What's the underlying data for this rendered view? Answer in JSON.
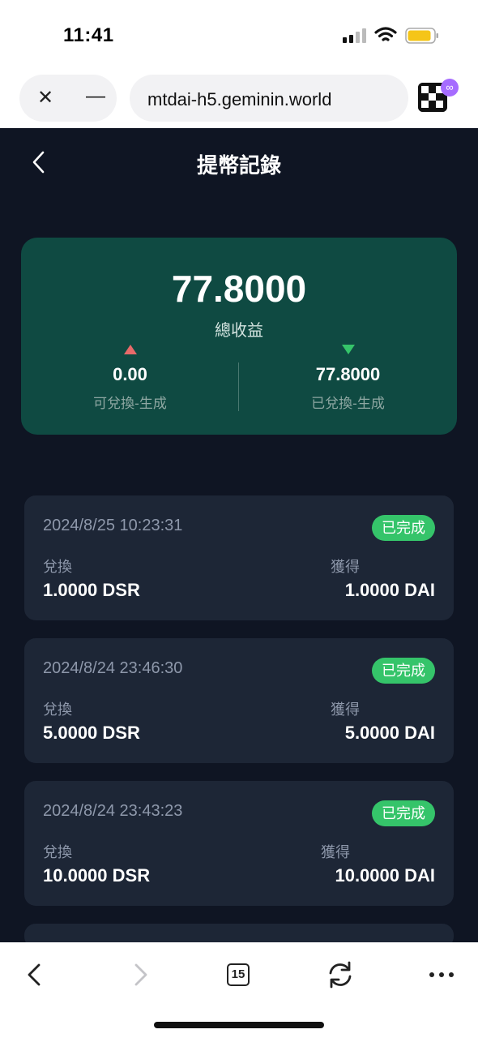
{
  "status_bar": {
    "time": "11:41"
  },
  "browser": {
    "url": "mtdai-h5.geminin.world",
    "tab_count": "15"
  },
  "header": {
    "title": "提幣記錄"
  },
  "summary": {
    "total": "77.8000",
    "total_label": "總收益",
    "left": {
      "value": "0.00",
      "label": "可兌換-生成"
    },
    "right": {
      "value": "77.8000",
      "label": "已兌換-生成"
    }
  },
  "records": [
    {
      "time": "2024/8/25 10:23:31",
      "status": "已完成",
      "left_label": "兌換",
      "left_value": "1.0000 DSR",
      "right_label": "獲得",
      "right_value": "1.0000 DAI"
    },
    {
      "time": "2024/8/24 23:46:30",
      "status": "已完成",
      "left_label": "兌換",
      "left_value": "5.0000 DSR",
      "right_label": "獲得",
      "right_value": "5.0000 DAI"
    },
    {
      "time": "2024/8/24 23:43:23",
      "status": "已完成",
      "left_label": "兌換",
      "left_value": "10.0000 DSR",
      "right_label": "獲得",
      "right_value": "10.0000 DAI"
    }
  ],
  "colors": {
    "background": "#0f1523",
    "summary_bg": "#0f4a42",
    "card_bg": "#1d2636",
    "status_green": "#35c46a",
    "up_arrow": "#e86a6a"
  }
}
